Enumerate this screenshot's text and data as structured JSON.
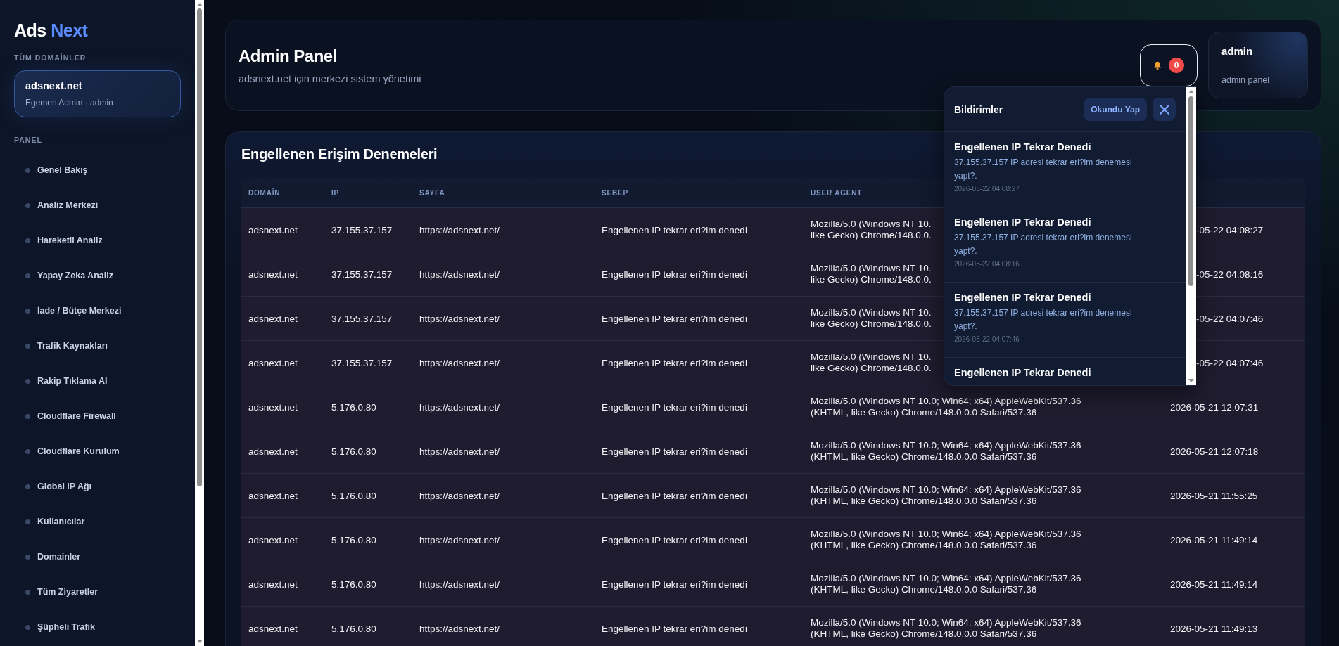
{
  "brand": {
    "first": "Ads",
    "second": "Next"
  },
  "sidebar": {
    "domains_heading": "TÜM DOMAİNLER",
    "domain_card": {
      "name": "adsnext.net",
      "subtitle": "Egemen Admin · admin"
    },
    "panel_heading": "PANEL",
    "items": [
      {
        "label": "Genel Bakış"
      },
      {
        "label": "Analiz Merkezi"
      },
      {
        "label": "Hareketli Analiz"
      },
      {
        "label": "Yapay Zeka Analiz"
      },
      {
        "label": "İade / Bütçe Merkezi"
      },
      {
        "label": "Trafik Kaynakları"
      },
      {
        "label": "Rakip Tıklama AI"
      },
      {
        "label": "Cloudflare Firewall"
      },
      {
        "label": "Cloudflare Kurulum"
      },
      {
        "label": "Global IP Ağı"
      },
      {
        "label": "Kullanıcılar"
      },
      {
        "label": "Domainler"
      },
      {
        "label": "Tüm Ziyaretler"
      },
      {
        "label": "Şüpheli Trafik"
      }
    ]
  },
  "header": {
    "title": "Admin Panel",
    "subtitle": "adsnext.net için merkezi sistem yönetimi",
    "notification_count": "0",
    "user": {
      "name": "admin",
      "role": "admin panel"
    }
  },
  "notifications": {
    "title": "Bildirimler",
    "mark_read": "Okundu Yap",
    "items": [
      {
        "title": "Engellenen IP Tekrar Denedi",
        "message": "37.155.37.157 IP adresi tekrar eri?im denemesi yapt?.",
        "time": "2026-05-22 04:08:27"
      },
      {
        "title": "Engellenen IP Tekrar Denedi",
        "message": "37.155.37.157 IP adresi tekrar eri?im denemesi yapt?.",
        "time": "2026-05-22 04:08:16"
      },
      {
        "title": "Engellenen IP Tekrar Denedi",
        "message": "37.155.37.157 IP adresi tekrar eri?im denemesi yapt?.",
        "time": "2026-05-22 04:07:46"
      },
      {
        "title": "Engellenen IP Tekrar Denedi"
      }
    ]
  },
  "table": {
    "title": "Engellenen Erişim Denemeleri",
    "columns": [
      "DOMAİN",
      "IP",
      "SAYFA",
      "SEBEP",
      "USER AGENT"
    ],
    "rows": [
      {
        "kind": "covered",
        "domain": "adsnext.net",
        "ip": "37.155.37.157",
        "page": "https://adsnext.net/",
        "reason": "Engellenen IP tekrar eri?im denedi",
        "user_agent_lines": [
          "Mozilla/5.0 (Windows NT 10.",
          "like Gecko) Chrome/148.0.0."
        ],
        "time": "-05-22 04:08:27"
      },
      {
        "kind": "covered",
        "domain": "adsnext.net",
        "ip": "37.155.37.157",
        "page": "https://adsnext.net/",
        "reason": "Engellenen IP tekrar eri?im denedi",
        "user_agent_lines": [
          "Mozilla/5.0 (Windows NT 10.",
          "like Gecko) Chrome/148.0.0."
        ],
        "time": "-05-22 04:08:16"
      },
      {
        "kind": "covered",
        "domain": "adsnext.net",
        "ip": "37.155.37.157",
        "page": "https://adsnext.net/",
        "reason": "Engellenen IP tekrar eri?im denedi",
        "user_agent_lines": [
          "Mozilla/5.0 (Windows NT 10.",
          "like Gecko) Chrome/148.0.0."
        ],
        "time": "-05-22 04:07:46"
      },
      {
        "kind": "covered",
        "domain": "adsnext.net",
        "ip": "37.155.37.157",
        "page": "https://adsnext.net/",
        "reason": "Engellenen IP tekrar eri?im denedi",
        "user_agent_lines": [
          "Mozilla/5.0 (Windows NT 10.",
          "like Gecko) Chrome/148.0.0."
        ],
        "time": "-05-22 04:07:46"
      },
      {
        "kind": "full",
        "domain": "adsnext.net",
        "ip": "5.176.0.80",
        "page": "https://adsnext.net/",
        "reason": "Engellenen IP tekrar eri?im denedi",
        "user_agent": "Mozilla/5.0 (Windows NT 10.0; Win64; x64) AppleWebKit/537.36 (KHTML, like Gecko) Chrome/148.0.0.0 Safari/537.36",
        "time": "2026-05-21 12:07:31"
      },
      {
        "kind": "full",
        "domain": "adsnext.net",
        "ip": "5.176.0.80",
        "page": "https://adsnext.net/",
        "reason": "Engellenen IP tekrar eri?im denedi",
        "user_agent": "Mozilla/5.0 (Windows NT 10.0; Win64; x64) AppleWebKit/537.36 (KHTML, like Gecko) Chrome/148.0.0.0 Safari/537.36",
        "time": "2026-05-21 12:07:18"
      },
      {
        "kind": "full",
        "domain": "adsnext.net",
        "ip": "5.176.0.80",
        "page": "https://adsnext.net/",
        "reason": "Engellenen IP tekrar eri?im denedi",
        "user_agent": "Mozilla/5.0 (Windows NT 10.0; Win64; x64) AppleWebKit/537.36 (KHTML, like Gecko) Chrome/148.0.0.0 Safari/537.36",
        "time": "2026-05-21 11:55:25"
      },
      {
        "kind": "full",
        "domain": "adsnext.net",
        "ip": "5.176.0.80",
        "page": "https://adsnext.net/",
        "reason": "Engellenen IP tekrar eri?im denedi",
        "user_agent": "Mozilla/5.0 (Windows NT 10.0; Win64; x64) AppleWebKit/537.36 (KHTML, like Gecko) Chrome/148.0.0.0 Safari/537.36",
        "time": "2026-05-21 11:49:14"
      },
      {
        "kind": "full",
        "domain": "adsnext.net",
        "ip": "5.176.0.80",
        "page": "https://adsnext.net/",
        "reason": "Engellenen IP tekrar eri?im denedi",
        "user_agent": "Mozilla/5.0 (Windows NT 10.0; Win64; x64) AppleWebKit/537.36 (KHTML, like Gecko) Chrome/148.0.0.0 Safari/537.36",
        "time": "2026-05-21 11:49:14"
      },
      {
        "kind": "full",
        "domain": "adsnext.net",
        "ip": "5.176.0.80",
        "page": "https://adsnext.net/",
        "reason": "Engellenen IP tekrar eri?im denedi",
        "user_agent": "Mozilla/5.0 (Windows NT 10.0; Win64; x64) AppleWebKit/537.36 (KHTML, like Gecko) Chrome/148.0.0.0 Safari/537.36",
        "time": "2026-05-21 11:49:13"
      }
    ]
  }
}
